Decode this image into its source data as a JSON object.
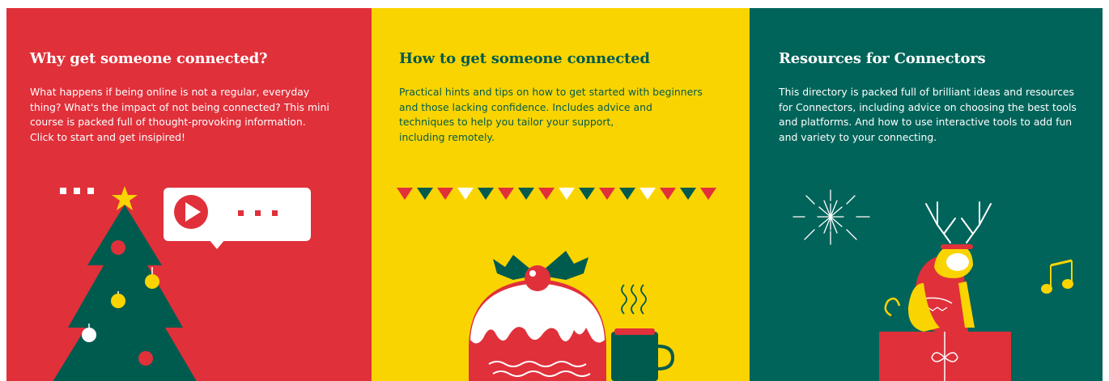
{
  "colors": {
    "red": "#E0303A",
    "yellow": "#FAD400",
    "teal": "#00645A",
    "dark_green": "#005B4F",
    "white": "#FFFFFF",
    "text_on_yellow": "#005B4F"
  },
  "cards": [
    {
      "title": "Why get someone connected?",
      "body": "What happens if being online is not a regular, everyday\nthing? What's the impact of not being connected? This mini\ncourse is packed full of thought-provoking information.\nClick to start and get insipired!",
      "illustration": "christmas-tree-and-video-bubble"
    },
    {
      "title": "How to get someone connected",
      "body": "Practical hints and tips on how to get started with beginners\nand those lacking confidence. Includes advice and\ntechniques to help you tailor your support,\nincluding remotely.",
      "illustration": "christmas-pudding-bunting-and-mug"
    },
    {
      "title": "Resources for Connectors",
      "body": "This directory is packed full of brilliant ideas and resources\nfor Connectors, including advice on choosing the best tools\nand platforms. And how to use interactive tools to add fun\nand variety to your connecting.",
      "illustration": "reindeer-dog-on-gift-box"
    }
  ]
}
